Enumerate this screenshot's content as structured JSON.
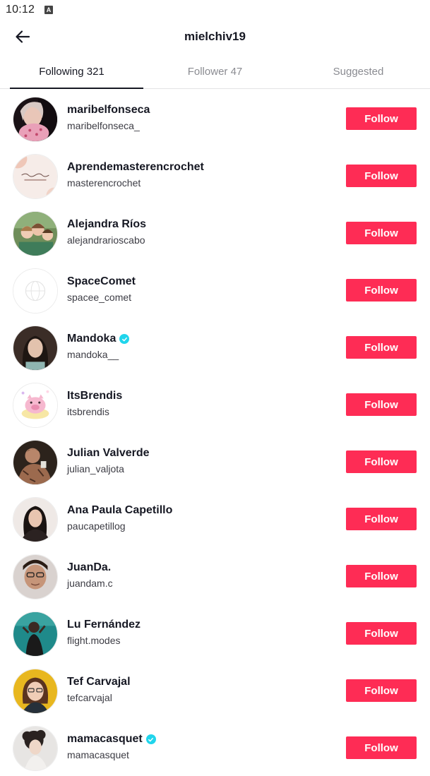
{
  "status_bar": {
    "time": "10:12",
    "notification_icon": "A"
  },
  "header": {
    "title": "mielchiv19",
    "back_icon": "arrow-left-icon"
  },
  "tabs": [
    {
      "label": "Following 321",
      "active": true
    },
    {
      "label": "Follower 47",
      "active": false
    },
    {
      "label": "Suggested",
      "active": false
    }
  ],
  "colors": {
    "follow_button": "#fe2c55",
    "verified_badge": "#20d5ec",
    "active_tab_underline": "#161823"
  },
  "users": [
    {
      "display_name": "maribelfonseca",
      "handle": "maribelfonseca_",
      "verified": false,
      "button": "Follow"
    },
    {
      "display_name": "Aprendemasterencrochet",
      "handle": "masterencrochet",
      "verified": false,
      "button": "Follow"
    },
    {
      "display_name": "Alejandra Ríos",
      "handle": "alejandrarioscabo",
      "verified": false,
      "button": "Follow"
    },
    {
      "display_name": "SpaceComet",
      "handle": "spacee_comet",
      "verified": false,
      "button": "Follow"
    },
    {
      "display_name": "Mandoka",
      "handle": "mandoka__",
      "verified": true,
      "button": "Follow"
    },
    {
      "display_name": "ItsBrendis",
      "handle": "itsbrendis",
      "verified": false,
      "button": "Follow"
    },
    {
      "display_name": "Julian Valverde",
      "handle": "julian_valjota",
      "verified": false,
      "button": "Follow"
    },
    {
      "display_name": "Ana Paula Capetillo",
      "handle": "paucapetillog",
      "verified": false,
      "button": "Follow"
    },
    {
      "display_name": "JuanDa.",
      "handle": "juandam.c",
      "verified": false,
      "button": "Follow"
    },
    {
      "display_name": "Lu Fernández",
      "handle": "flight.modes",
      "verified": false,
      "button": "Follow"
    },
    {
      "display_name": "Tef Carvajal",
      "handle": "tefcarvajal",
      "verified": false,
      "button": "Follow"
    },
    {
      "display_name": "mamacasquet",
      "handle": "mamacasquet",
      "verified": true,
      "button": "Follow"
    }
  ]
}
